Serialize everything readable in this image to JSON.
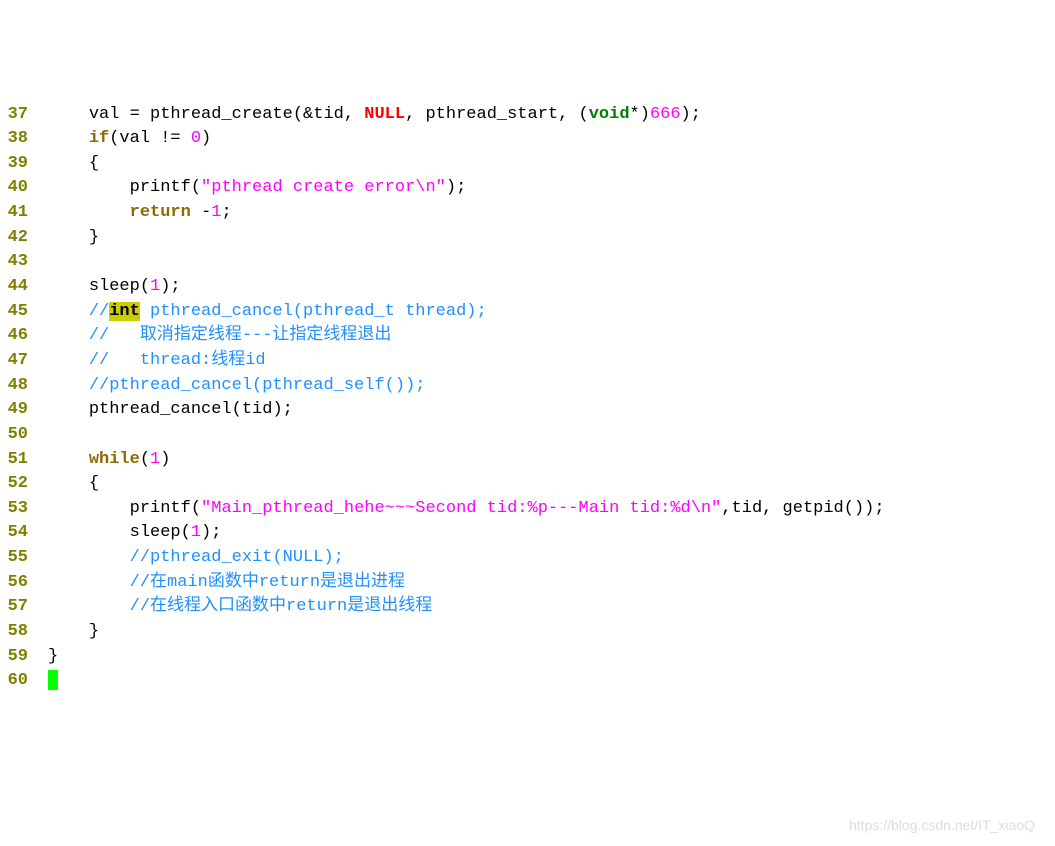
{
  "watermark": "https://blog.csdn.net/IT_xiaoQ",
  "lines": [
    {
      "n": "37",
      "indent": "    ",
      "tokens": [
        {
          "t": "val = pthread_create(&tid, ",
          "c": "plain"
        },
        {
          "t": "NULL",
          "c": "k-null"
        },
        {
          "t": ", pthread_start, (",
          "c": "plain"
        },
        {
          "t": "void",
          "c": "k-type"
        },
        {
          "t": "*)",
          "c": "plain"
        },
        {
          "t": "666",
          "c": "num"
        },
        {
          "t": ");",
          "c": "plain"
        }
      ]
    },
    {
      "n": "38",
      "indent": "    ",
      "tokens": [
        {
          "t": "if",
          "c": "k-ctrl"
        },
        {
          "t": "(val != ",
          "c": "plain"
        },
        {
          "t": "0",
          "c": "num"
        },
        {
          "t": ")",
          "c": "plain"
        }
      ]
    },
    {
      "n": "39",
      "indent": "    ",
      "tokens": [
        {
          "t": "{",
          "c": "plain"
        }
      ]
    },
    {
      "n": "40",
      "indent": "        ",
      "tokens": [
        {
          "t": "printf(",
          "c": "plain"
        },
        {
          "t": "\"pthread create error\\n\"",
          "c": "str"
        },
        {
          "t": ");",
          "c": "plain"
        }
      ]
    },
    {
      "n": "41",
      "indent": "        ",
      "tokens": [
        {
          "t": "return",
          "c": "k-ctrl"
        },
        {
          "t": " -",
          "c": "plain"
        },
        {
          "t": "1",
          "c": "num"
        },
        {
          "t": ";",
          "c": "plain"
        }
      ]
    },
    {
      "n": "42",
      "indent": "    ",
      "tokens": [
        {
          "t": "}",
          "c": "plain"
        }
      ]
    },
    {
      "n": "43",
      "indent": "",
      "tokens": []
    },
    {
      "n": "44",
      "indent": "    ",
      "tokens": [
        {
          "t": "sleep(",
          "c": "plain"
        },
        {
          "t": "1",
          "c": "num"
        },
        {
          "t": ");",
          "c": "plain"
        }
      ]
    },
    {
      "n": "45",
      "indent": "    ",
      "tokens": [
        {
          "t": "//",
          "c": "comment"
        },
        {
          "t": "int",
          "c": "hl"
        },
        {
          "t": " pthread_cancel(pthread_t thread);",
          "c": "comment"
        }
      ]
    },
    {
      "n": "46",
      "indent": "    ",
      "tokens": [
        {
          "t": "//   取消指定线程---让指定线程退出",
          "c": "comment"
        }
      ]
    },
    {
      "n": "47",
      "indent": "    ",
      "tokens": [
        {
          "t": "//   thread:线程id",
          "c": "comment"
        }
      ]
    },
    {
      "n": "48",
      "indent": "    ",
      "tokens": [
        {
          "t": "//pthread_cancel(pthread_self());",
          "c": "comment"
        }
      ]
    },
    {
      "n": "49",
      "indent": "    ",
      "tokens": [
        {
          "t": "pthread_cancel(tid);",
          "c": "plain"
        }
      ]
    },
    {
      "n": "50",
      "indent": "",
      "tokens": []
    },
    {
      "n": "51",
      "indent": "    ",
      "tokens": [
        {
          "t": "while",
          "c": "k-ctrl"
        },
        {
          "t": "(",
          "c": "plain"
        },
        {
          "t": "1",
          "c": "num"
        },
        {
          "t": ")",
          "c": "plain"
        }
      ]
    },
    {
      "n": "52",
      "indent": "    ",
      "tokens": [
        {
          "t": "{",
          "c": "plain"
        }
      ]
    },
    {
      "n": "53",
      "indent": "        ",
      "tokens": [
        {
          "t": "printf(",
          "c": "plain"
        },
        {
          "t": "\"Main_pthread_hehe~~~Second tid:%p---Main tid:%d\\n\"",
          "c": "str"
        },
        {
          "t": ",tid, getpid());",
          "c": "plain"
        }
      ]
    },
    {
      "n": "54",
      "indent": "        ",
      "tokens": [
        {
          "t": "sleep(",
          "c": "plain"
        },
        {
          "t": "1",
          "c": "num"
        },
        {
          "t": ");",
          "c": "plain"
        }
      ]
    },
    {
      "n": "55",
      "indent": "        ",
      "tokens": [
        {
          "t": "//pthread_exit(NULL);",
          "c": "comment"
        }
      ]
    },
    {
      "n": "56",
      "indent": "        ",
      "tokens": [
        {
          "t": "//在main函数中return是退出进程",
          "c": "comment"
        }
      ]
    },
    {
      "n": "57",
      "indent": "        ",
      "tokens": [
        {
          "t": "//在线程入口函数中return是退出线程",
          "c": "comment"
        }
      ]
    },
    {
      "n": "58",
      "indent": "    ",
      "tokens": [
        {
          "t": "}",
          "c": "plain"
        }
      ]
    },
    {
      "n": "59",
      "indent": "",
      "tokens": [
        {
          "t": "}",
          "c": "plain"
        }
      ]
    },
    {
      "n": "60",
      "indent": "",
      "tokens": [],
      "cursor": true
    }
  ]
}
